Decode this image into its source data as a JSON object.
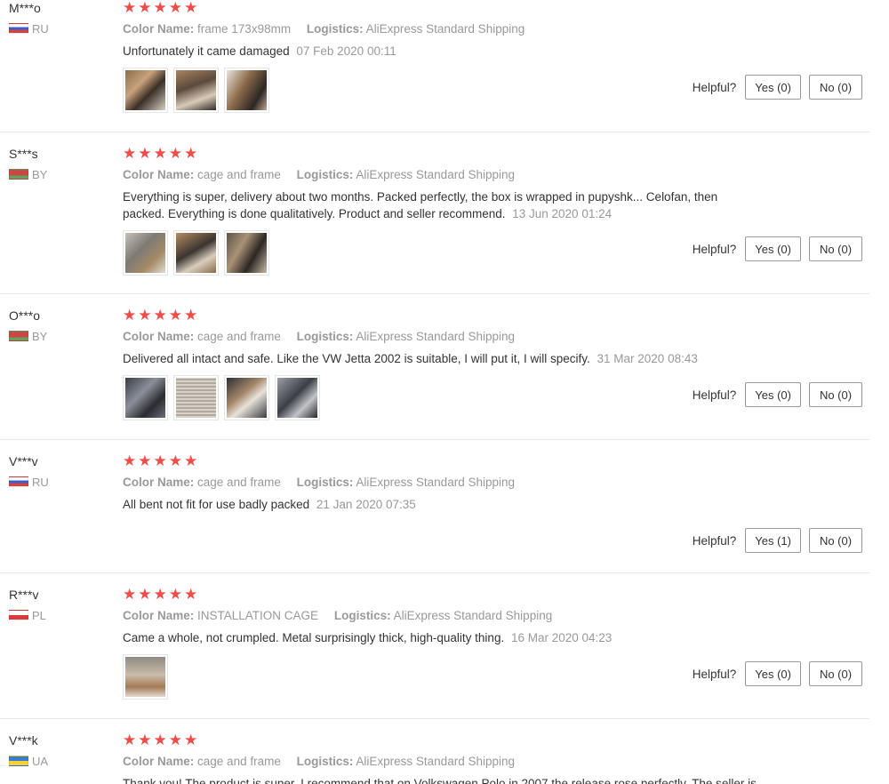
{
  "reviews": [
    {
      "user": "M***o",
      "country": "RU",
      "flag": "ru",
      "stars": 5,
      "color_label": "Color Name:",
      "color_value": "frame 173x98mm",
      "logistics_label": "Logistics:",
      "logistics_value": "AliExpress Standard Shipping",
      "text": "Unfortunately it came damaged",
      "date": "07 Feb 2020 00:11",
      "photos": 3,
      "helpful_label": "Helpful?",
      "yes": "Yes (0)",
      "no": "No (0)"
    },
    {
      "user": "S***s",
      "country": "BY",
      "flag": "by",
      "stars": 5,
      "color_label": "Color Name:",
      "color_value": "cage and frame",
      "logistics_label": "Logistics:",
      "logistics_value": "AliExpress Standard Shipping",
      "text": "Everything is super, delivery about two months. Packed perfectly, the box is wrapped in pupyshk... Celofan, then packed. Everything is done qualitatively. Product and seller recommend.",
      "date": "13 Jun 2020 01:24",
      "photos": 3,
      "helpful_label": "Helpful?",
      "yes": "Yes (0)",
      "no": "No (0)"
    },
    {
      "user": "O***o",
      "country": "BY",
      "flag": "by",
      "stars": 5,
      "color_label": "Color Name:",
      "color_value": "cage and frame",
      "logistics_label": "Logistics:",
      "logistics_value": "AliExpress Standard Shipping",
      "text": "Delivered all intact and safe. Like the VW Jetta 2002 is suitable, I will put it, I will specify.",
      "date": "31 Mar 2020 08:43",
      "photos": 4,
      "helpful_label": "Helpful?",
      "yes": "Yes (0)",
      "no": "No (0)"
    },
    {
      "user": "V***v",
      "country": "RU",
      "flag": "ru",
      "stars": 5,
      "color_label": "Color Name:",
      "color_value": "cage and frame",
      "logistics_label": "Logistics:",
      "logistics_value": "AliExpress Standard Shipping",
      "text": "All bent not fit for use badly packed",
      "date": "21 Jan 2020 07:35",
      "photos": 0,
      "helpful_label": "Helpful?",
      "yes": "Yes (1)",
      "no": "No (0)"
    },
    {
      "user": "R***v",
      "country": "PL",
      "flag": "pl",
      "stars": 5,
      "color_label": "Color Name:",
      "color_value": "INSTALLATION CAGE",
      "logistics_label": "Logistics:",
      "logistics_value": "AliExpress Standard Shipping",
      "text": "Came a whole, not crumpled. Metal surprisingly thick, high-quality thing.",
      "date": "16 Mar 2020 04:23",
      "photos": 1,
      "helpful_label": "Helpful?",
      "yes": "Yes (0)",
      "no": "No (0)"
    },
    {
      "user": "V***k",
      "country": "UA",
      "flag": "ua",
      "stars": 5,
      "color_label": "Color Name:",
      "color_value": "cage and frame",
      "logistics_label": "Logistics:",
      "logistics_value": "AliExpress Standard Shipping",
      "text": "Thank you! The product is super. I recommend that on Volkswagen Polo in 2007 the release rose perfectly. The seller is",
      "date": "",
      "photos": 0,
      "helpful_label": "",
      "yes": "",
      "no": ""
    }
  ],
  "colors": {
    "star": "#f04d48",
    "muted": "#999999",
    "text": "#333333",
    "divider": "#e8e8e8"
  },
  "icons": {
    "star": "star-icon",
    "flag": "flag-icon"
  }
}
